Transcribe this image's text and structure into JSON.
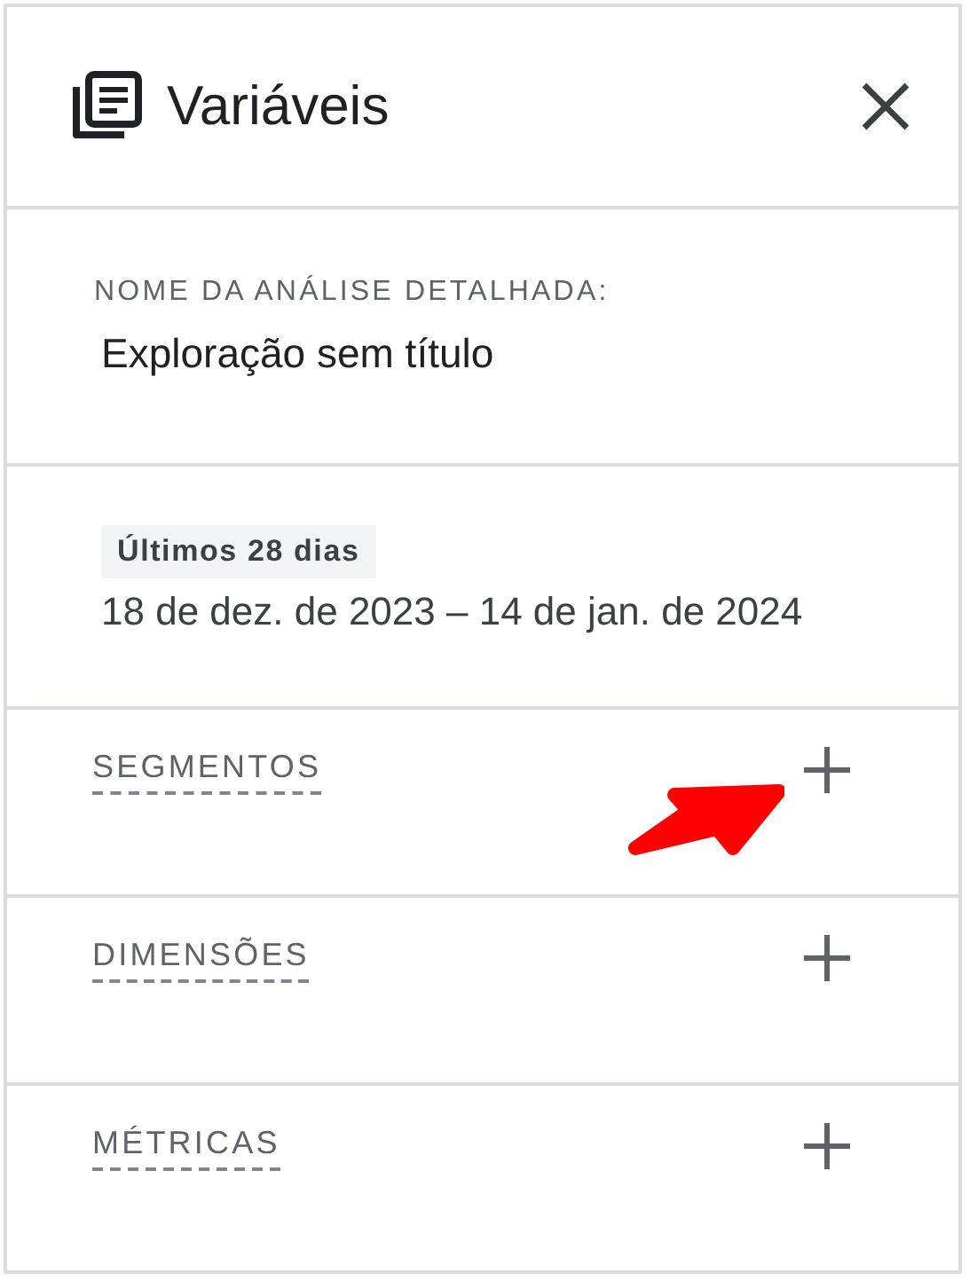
{
  "panel": {
    "title": "Variáveis"
  },
  "exploration": {
    "label": "NOME DA ANÁLISE DETALHADA:",
    "value": "Exploração sem título"
  },
  "date_range": {
    "preset": "Últimos 28 dias",
    "range": "18 de dez. de 2023 – 14 de jan. de 2024"
  },
  "sections": [
    {
      "label": "SEGMENTOS",
      "highlighted": true
    },
    {
      "label": "DIMENSÕES",
      "highlighted": false
    },
    {
      "label": "MÉTRICAS",
      "highlighted": false
    }
  ]
}
